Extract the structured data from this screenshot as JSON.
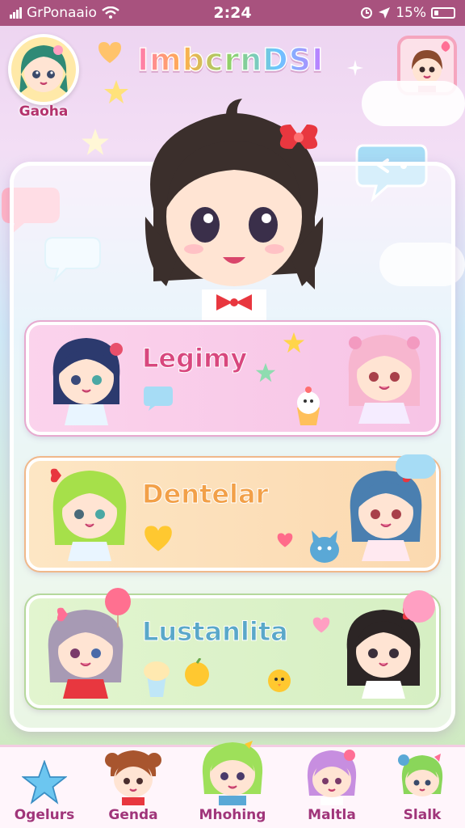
{
  "status_bar": {
    "carrier": "GrPonaaio",
    "time": "2:24",
    "battery": "15%",
    "icons": [
      "signal-icon",
      "wifi-icon",
      "alarm-icon",
      "location-icon",
      "battery-icon"
    ]
  },
  "header": {
    "title": "ImbcrnDSI",
    "profile_label": "Gaoha",
    "icons": [
      "profile-avatar",
      "user-avatar"
    ]
  },
  "cards": [
    {
      "title": "Legimy",
      "color": "#d8477e"
    },
    {
      "title": "Dentelar",
      "color": "#f2a048"
    },
    {
      "title": "Lustanlita",
      "color": "#5aa8c9"
    }
  ],
  "tabs": [
    {
      "label": "Ogelurs",
      "icon": "star-icon"
    },
    {
      "label": "Genda",
      "icon": "character-icon"
    },
    {
      "label": "Mhohing",
      "icon": "character-icon"
    },
    {
      "label": "Maltla",
      "icon": "character-icon"
    },
    {
      "label": "Slalk",
      "icon": "character-icon"
    }
  ],
  "colors": {
    "status_bar": "#a8527e",
    "accent": "#d8477e",
    "tab_text": "#a0357a"
  }
}
